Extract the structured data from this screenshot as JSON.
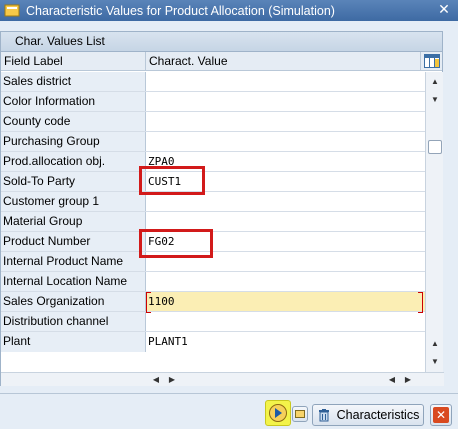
{
  "window": {
    "title": "Characteristic Values for Product Allocation (Simulation)",
    "close_glyph": "✕"
  },
  "panel": {
    "header": "Char. Values List",
    "columns": {
      "field_label": "Field Label",
      "charact_value": "Charact. Value"
    }
  },
  "rows": [
    {
      "label": "Sales district",
      "value": ""
    },
    {
      "label": "Color Information",
      "value": ""
    },
    {
      "label": "County code",
      "value": ""
    },
    {
      "label": "Purchasing Group",
      "value": ""
    },
    {
      "label": "Prod.allocation obj.",
      "value": "ZPA0"
    },
    {
      "label": "Sold-To Party",
      "value": "CUST1"
    },
    {
      "label": "Customer group 1",
      "value": ""
    },
    {
      "label": "Material Group",
      "value": ""
    },
    {
      "label": "Product Number",
      "value": "FG02"
    },
    {
      "label": "Internal Product Name",
      "value": ""
    },
    {
      "label": "Internal Location Name",
      "value": ""
    },
    {
      "label": "Sales Organization",
      "value": "1100"
    },
    {
      "label": "Distribution channel",
      "value": ""
    },
    {
      "label": "Plant",
      "value": "PLANT1"
    }
  ],
  "toolbar": {
    "characteristics_label": "Characteristics",
    "cancel_glyph": "✕"
  },
  "colors": {
    "title_bar": "#3e6aa3",
    "highlight_row": "#fbeeb4",
    "annotation_red": "#d21a1a",
    "exec_highlight": "#f3f34a"
  }
}
